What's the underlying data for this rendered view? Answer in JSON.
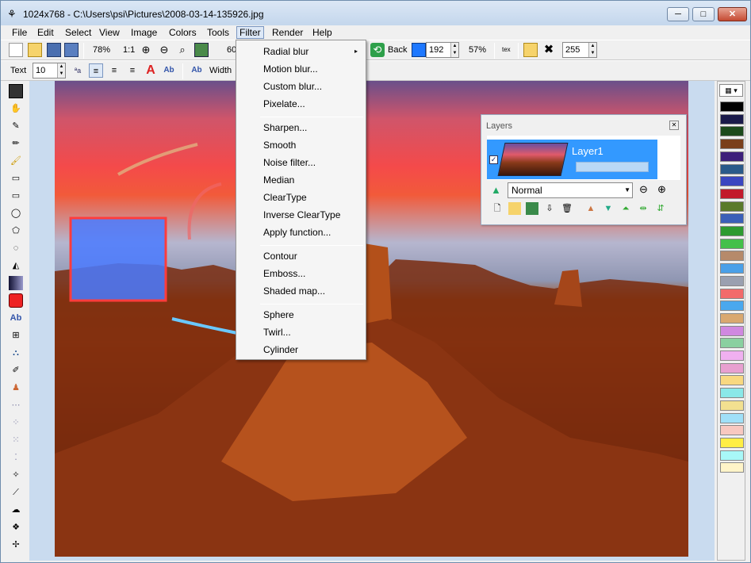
{
  "window": {
    "title": "1024x768 - C:\\Users\\psi\\Pictures\\2008-03-14-135926.jpg",
    "min": "─",
    "max": "□",
    "close": "✕",
    "app_icon": "⚘"
  },
  "menubar": [
    "File",
    "Edit",
    "Select",
    "View",
    "Image",
    "Colors",
    "Tools",
    "Filter",
    "Render",
    "Help"
  ],
  "toolbar1": {
    "zoom_percent": "78%",
    "zoom_1_1": "1:1",
    "zoom_partial": "60",
    "back_label": "Back",
    "back_value": "192",
    "zoom2": "57%",
    "tex_label": "tex",
    "value255": "255"
  },
  "toolbar2": {
    "text_label": "Text",
    "font_size": "10",
    "width_label": "Width"
  },
  "filter_menu": [
    "Radial blur",
    "Motion blur...",
    "Custom blur...",
    "Pixelate...",
    "Sharpen...",
    "Smooth",
    "Noise filter...",
    "Median",
    "ClearType",
    "Inverse ClearType",
    "Apply function...",
    "Contour",
    "Emboss...",
    "Shaded map...",
    "Sphere",
    "Twirl...",
    "Cylinder"
  ],
  "layers": {
    "title": "Layers",
    "layer_name": "Layer1",
    "blend_mode": "Normal"
  },
  "palette_colors": [
    "#000000",
    "#1a1a4a",
    "#1c4a1c",
    "#7a3f1a",
    "#3d1f7a",
    "#2a5a8a",
    "#3a46c0",
    "#c21a2a",
    "#5a7a2a",
    "#3b5fb8",
    "#2e9a30",
    "#44c04a",
    "#b68a6a",
    "#4aa0e8",
    "#9aa0b0",
    "#f26a6a",
    "#4aa8ee",
    "#d9a870",
    "#d088e0",
    "#8ad0a0",
    "#f0b0f0",
    "#e8a0d0",
    "#f8d880",
    "#8ae8e8",
    "#f2e090",
    "#a0e0f8",
    "#f8c8c0",
    "#ffee44",
    "#a8f8f8",
    "#fff4c8"
  ],
  "icons": {
    "new": "🗋",
    "open": "📂",
    "save": "💾",
    "zoom_in": "🔍",
    "redo": "⟳",
    "close": "✖",
    "arrow": "▸"
  }
}
